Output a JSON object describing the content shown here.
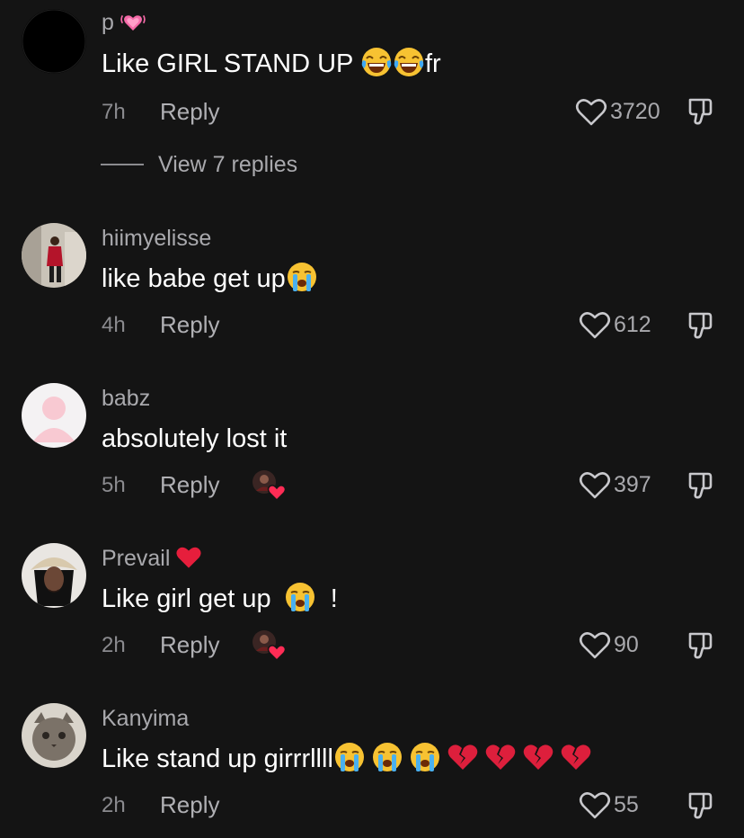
{
  "comments": [
    {
      "username": "p",
      "username_emoji": "growing-heart",
      "text": "Like GIRL STAND UP",
      "text_suffix": "fr",
      "time": "7h",
      "reply_label": "Reply",
      "likes": "3720",
      "view_replies": "View 7 replies"
    },
    {
      "username": "hiimyelisse",
      "text": "like babe get up",
      "time": "4h",
      "reply_label": "Reply",
      "likes": "612"
    },
    {
      "username": "babz",
      "text": "absolutely lost it",
      "time": "5h",
      "reply_label": "Reply",
      "likes": "397",
      "liked_by_creator": true
    },
    {
      "username": "Prevail",
      "username_emoji": "red-heart",
      "text": "Like girl get up",
      "text_suffix": "!",
      "time": "2h",
      "reply_label": "Reply",
      "likes": "90",
      "liked_by_creator": true
    },
    {
      "username": "Kanyima",
      "text": "Like stand up girrrllll",
      "time": "2h",
      "reply_label": "Reply",
      "likes": "55"
    }
  ],
  "colors": {
    "background": "#141414",
    "primary_text": "#ffffff",
    "secondary_text": "#a9a9ad",
    "icon_gray": "#c8c8cc",
    "heart_red": "#fe2c55"
  }
}
